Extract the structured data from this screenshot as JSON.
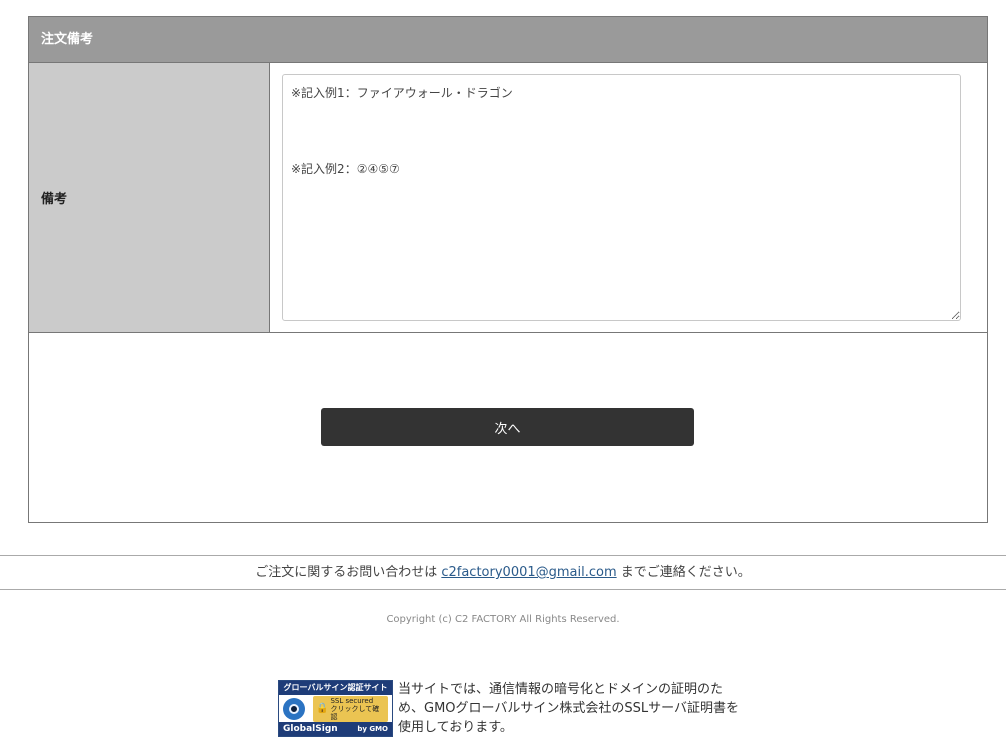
{
  "section": {
    "header": "注文備考",
    "row_label": "備考",
    "textarea_value": "※記入例1：ファイアウォール・ドラゴン\n\n\n\n※記入例2：②④⑤⑦"
  },
  "next_button": "次へ",
  "contact": {
    "prefix": "ご注文に関するお問い合わせは ",
    "email": "c2factory0001@gmail.com",
    "suffix": " までご連絡ください。"
  },
  "copyright": "Copyright (c) C2 FACTORY All Rights Reserved.",
  "ssl": {
    "seal_title": "グローバルサイン認証サイト",
    "seal_badge_line1": "SSL secured",
    "seal_badge_line2": "クリックして確認",
    "seal_brand": "GlobalSign",
    "seal_by": "by GMO",
    "description": "当サイトでは、通信情報の暗号化とドメインの証明のため、GMOグローバルサイン株式会社のSSLサーバ証明書を使用しております。"
  },
  "colors": {
    "header_bg": "#9a9a9a",
    "label_bg": "#cbcbcb",
    "button_bg": "#333333",
    "link": "#2a5a8a"
  }
}
